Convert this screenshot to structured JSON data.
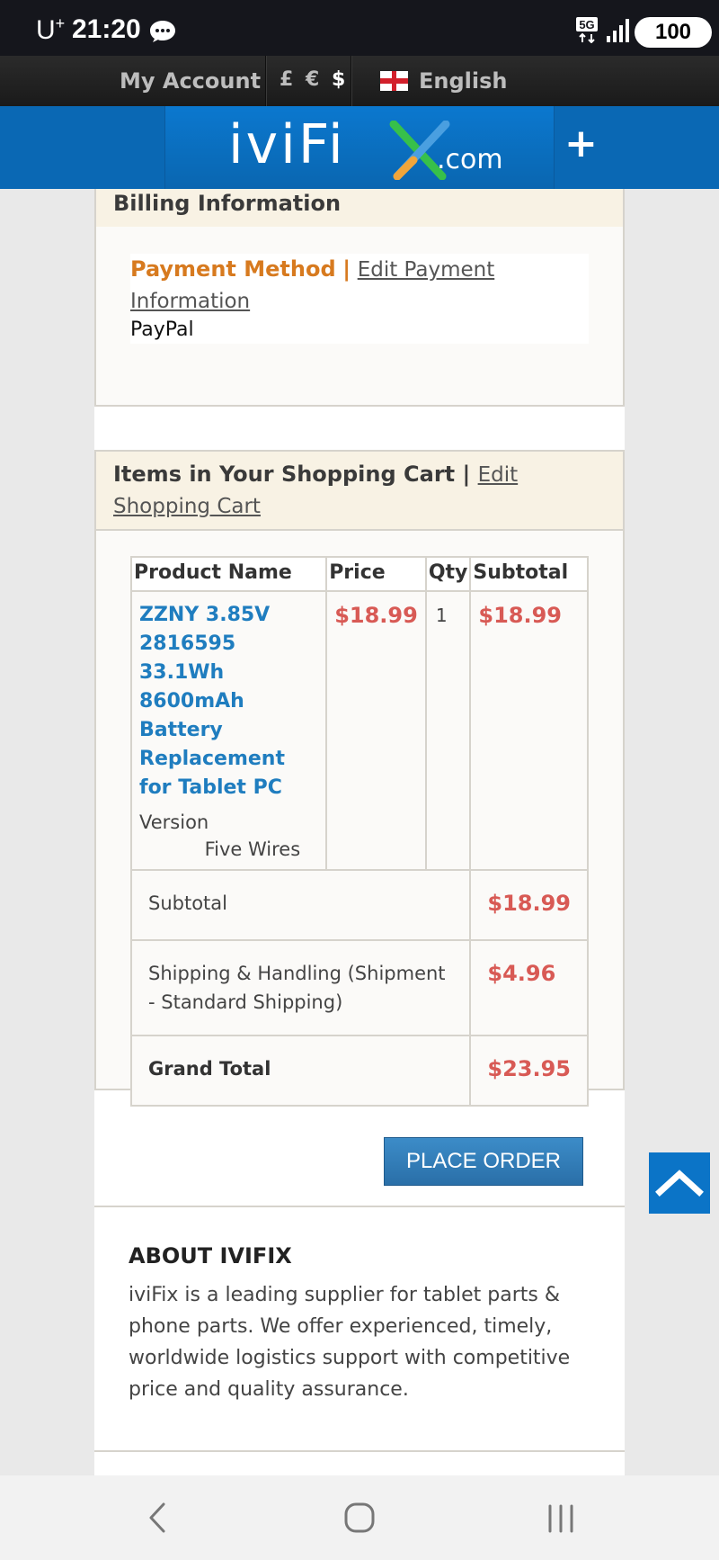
{
  "status_bar": {
    "carrier": "U",
    "carrier_sup": "+",
    "time": "21:20",
    "network": "5G",
    "battery": "100"
  },
  "top_bar": {
    "account_label": "My Account",
    "currencies": [
      "£",
      "€",
      "$"
    ],
    "language": "English"
  },
  "header": {
    "logo_text": "iviFi",
    "logo_domain": ".com",
    "menu_toggle": "+"
  },
  "billing": {
    "title": "Billing Information",
    "payment_label": "Payment Method",
    "separator": "|",
    "edit_link": "Edit Payment Information",
    "payment_value": "PayPal"
  },
  "cart": {
    "title": "Items in Your Shopping Cart",
    "separator": "|",
    "edit_link": "Edit Shopping Cart",
    "columns": [
      "Product Name",
      "Price",
      "Qty",
      "Subtotal"
    ],
    "item": {
      "name": "ZZNY 3.85V 2816595 33.1Wh 8600mAh Battery Replacement for Tablet PC",
      "option_label": "Version",
      "option_value": "Five Wires",
      "price": "$18.99",
      "qty": "1",
      "subtotal": "$18.99"
    },
    "totals": {
      "subtotal_label": "Subtotal",
      "subtotal_value": "$18.99",
      "shipping_label": "Shipping & Handling (Shipment - Standard Shipping)",
      "shipping_value": "$4.96",
      "grand_label": "Grand Total",
      "grand_value": "$23.95"
    }
  },
  "actions": {
    "place_order": "PLACE ORDER"
  },
  "about": {
    "title": "ABOUT IVIFIX",
    "text": "iviFix is a leading supplier for tablet parts & phone parts. We offer experienced, timely, worldwide logistics support with competitive price and quality assurance."
  },
  "colors": {
    "brand_blue": "#0a68b4",
    "price_red": "#d85a55",
    "payment_orange": "#d77a1f",
    "link_blue": "#1f7dbf"
  },
  "icons": {
    "message": "chat-bubble-icon",
    "scroll_top": "chevron-up-icon",
    "nav_back": "back-icon",
    "nav_home": "home-icon",
    "nav_recents": "recents-icon"
  }
}
